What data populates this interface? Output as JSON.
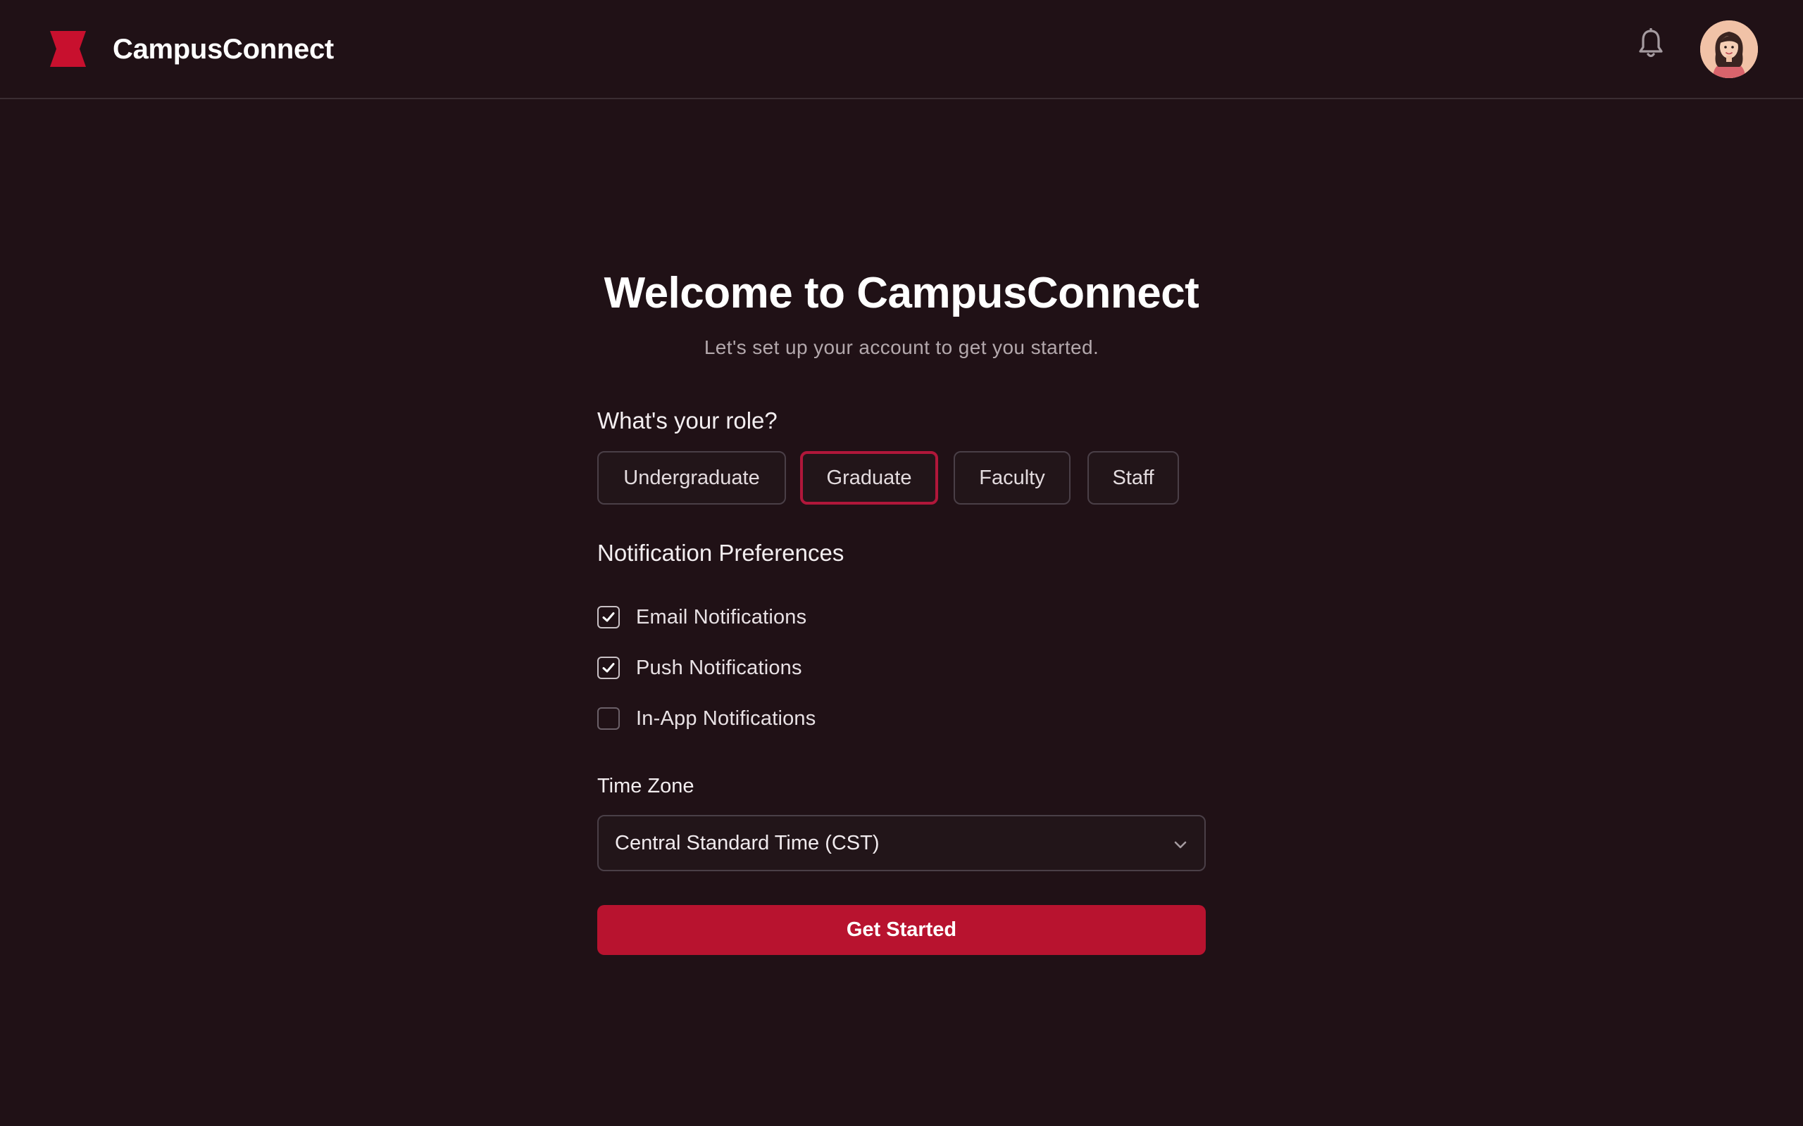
{
  "app": {
    "name": "CampusConnect",
    "accent_color": "#b8132f"
  },
  "header": {
    "logo_icon": "bowtie-logo-icon",
    "notification_icon": "bell-icon",
    "avatar_icon": "user-avatar"
  },
  "main": {
    "title": "Welcome to CampusConnect",
    "subtitle": "Let's set up your account to get you started.",
    "role_label": "What's your role?",
    "roles": [
      {
        "label": "Undergraduate",
        "selected": false
      },
      {
        "label": "Graduate",
        "selected": true
      },
      {
        "label": "Faculty",
        "selected": false
      },
      {
        "label": "Staff",
        "selected": false
      }
    ],
    "notifications_label": "Notification Preferences",
    "notifications": [
      {
        "label": "Email Notifications",
        "checked": true
      },
      {
        "label": "Push Notifications",
        "checked": true
      },
      {
        "label": "In-App Notifications",
        "checked": false
      }
    ],
    "timezone_label": "Time Zone",
    "timezone_value": "Central Standard Time (CST)",
    "submit_label": "Get Started"
  }
}
